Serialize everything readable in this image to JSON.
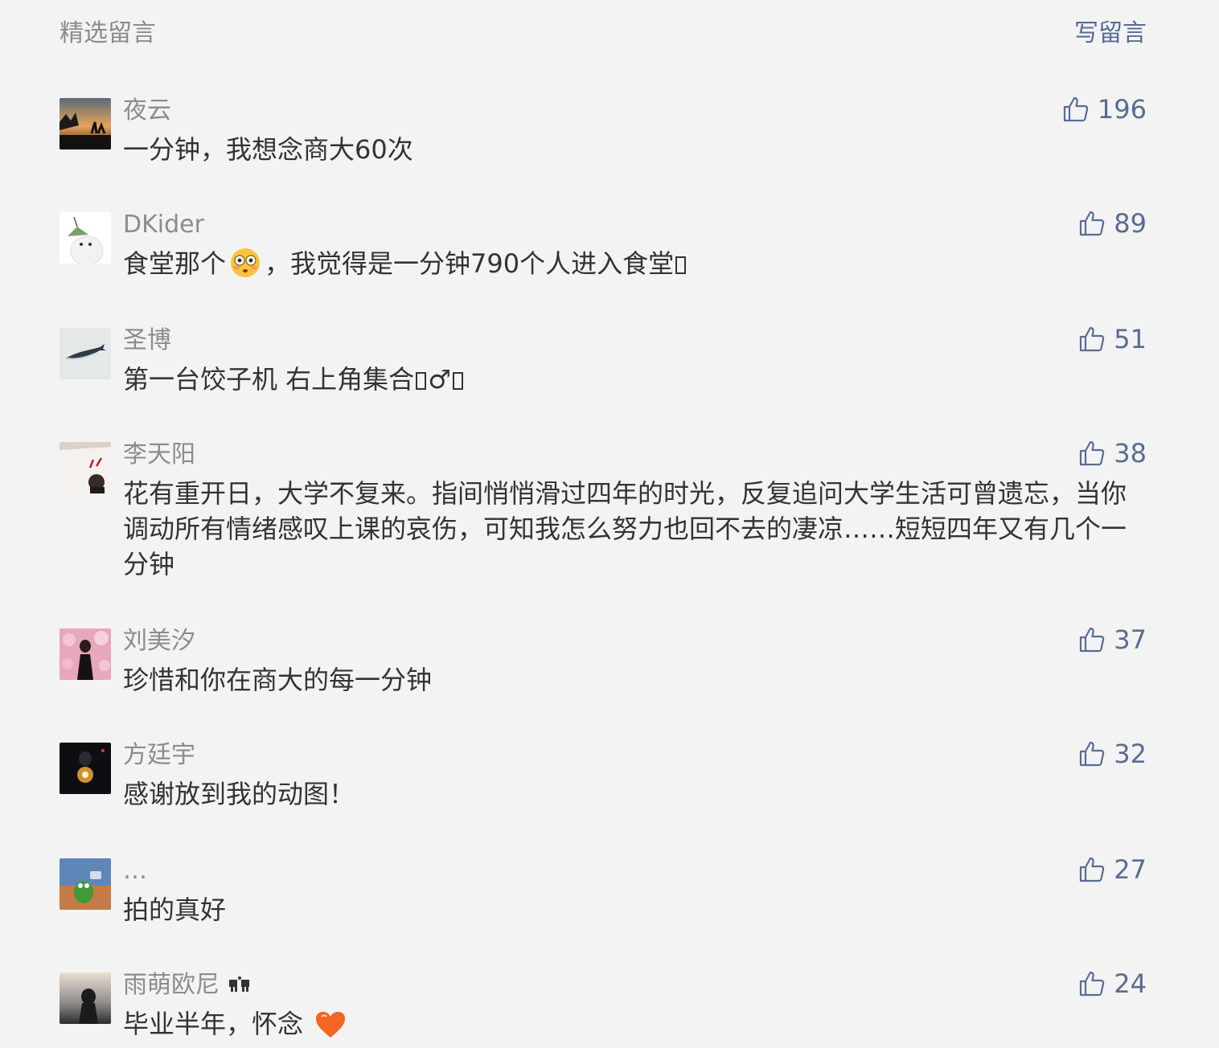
{
  "header": {
    "title": "精选留言",
    "write_label": "写留言"
  },
  "comments": [
    {
      "nickname": "夜云",
      "likes": "196",
      "text": "一分钟，我想念商大60次"
    },
    {
      "nickname": "DKider",
      "likes": "89",
      "text_a": "食堂那个",
      "text_b": "，我觉得是一分钟790个人进入食堂"
    },
    {
      "nickname": "圣博",
      "likes": "51",
      "text_a": "第一台饺子机 右上角集合",
      "text_b": "♂"
    },
    {
      "nickname": "李天阳",
      "likes": "38",
      "text": "花有重开日，大学不复来。指间悄悄滑过四年的时光，反复追问大学生活可曾遗忘，当你调动所有情绪感叹上课的哀伤，可知我怎么努力也回不去的凄凉……短短四年又有几个一分钟"
    },
    {
      "nickname": "刘美汐",
      "likes": "37",
      "text": "珍惜和你在商大的每一分钟"
    },
    {
      "nickname": "方廷宇",
      "likes": "32",
      "text": "感谢放到我的动图！"
    },
    {
      "nickname": "…",
      "likes": "27",
      "text": "拍的真好"
    },
    {
      "nickname": "雨萌欧尼",
      "likes": "24",
      "text": "毕业半年，怀念"
    }
  ],
  "icons": {
    "like": "thumbs-up-icon",
    "flushed": "flushed-face-emoji",
    "heart": "orange-heart-emoji",
    "badge": "cat-paw-icon"
  },
  "colors": {
    "background": "#f3f3f3",
    "link": "#586c94",
    "nickname": "#8c8c8c",
    "text": "#333333"
  }
}
